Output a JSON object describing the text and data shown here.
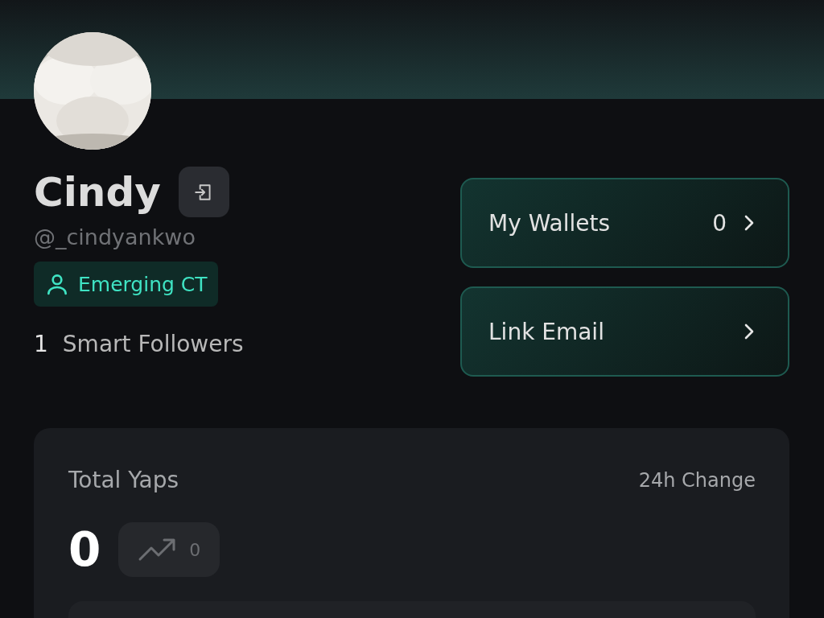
{
  "profile": {
    "name": "Cindy",
    "handle": "@_cindyankwo",
    "badge": {
      "label": "Emerging CT"
    },
    "smart_followers": {
      "count": "1",
      "label": "Smart Followers"
    }
  },
  "actions": [
    {
      "label": "My Wallets",
      "count": "0"
    },
    {
      "label": "Link Email"
    }
  ],
  "yaps": {
    "title": "Total Yaps",
    "change_label": "24h Change",
    "total": "0",
    "change": "0"
  }
}
